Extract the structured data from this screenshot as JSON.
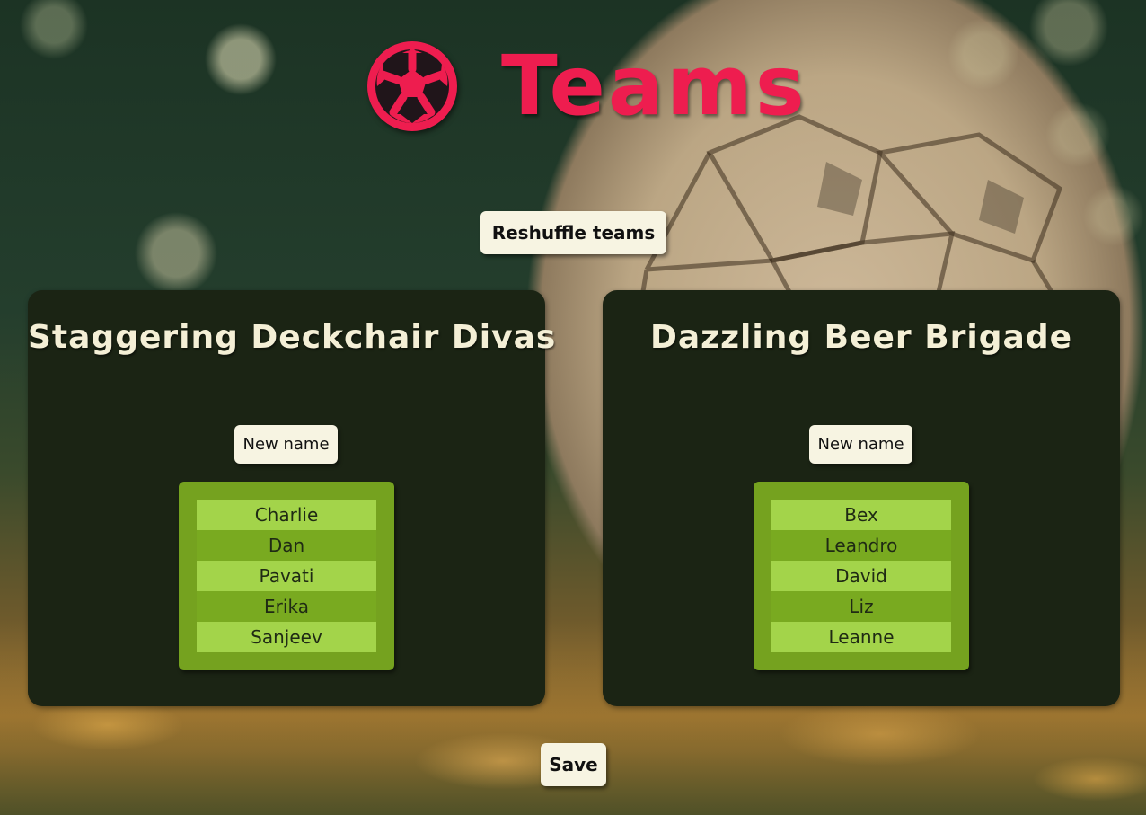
{
  "header": {
    "title": "Teams",
    "logo_icon": "soccer-ball-icon",
    "title_color": "#ee1d4f"
  },
  "actions": {
    "reshuffle_label": "Reshuffle teams",
    "save_label": "Save"
  },
  "teams": [
    {
      "name": "Staggering Deckchair Divas",
      "new_name_label": "New name",
      "players": [
        "Charlie",
        "Dan",
        "Pavati",
        "Erika",
        "Sanjeev"
      ]
    },
    {
      "name": "Dazzling Beer Brigade",
      "new_name_label": "New name",
      "players": [
        "Bex",
        "Leandro",
        "David",
        "Liz",
        "Leanne"
      ]
    }
  ],
  "colors": {
    "card_background": "#1b2414",
    "roster_light": "#a3d44a",
    "roster_dark": "#79aa20",
    "button_background": "#f7f4e2"
  }
}
